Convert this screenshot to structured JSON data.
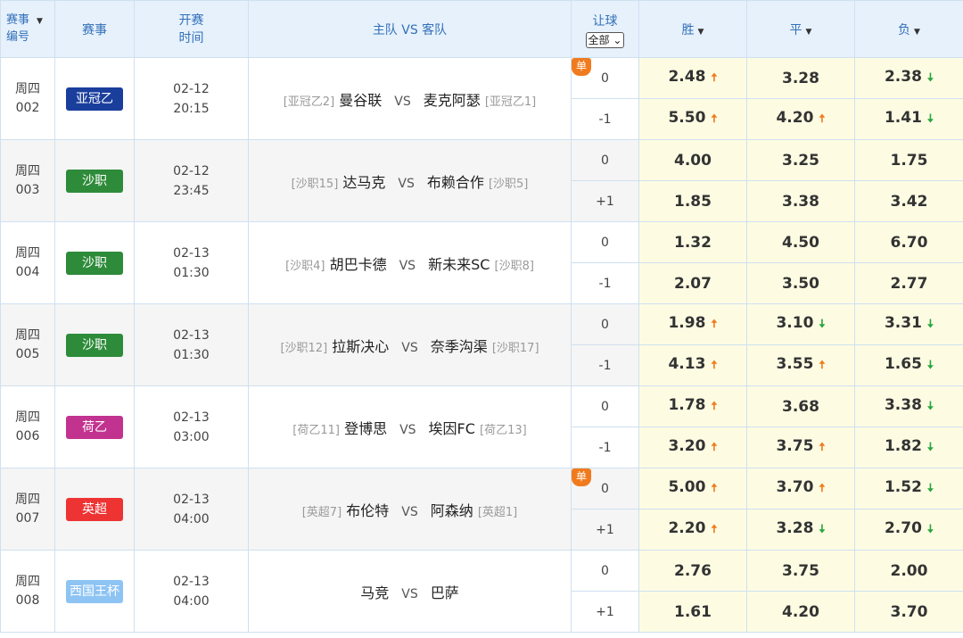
{
  "header": {
    "id_line1": "赛事",
    "id_line2": "编号",
    "league": "赛事",
    "time_line1": "开赛",
    "time_line2": "时间",
    "match": "主队 VS 客队",
    "handicap": "让球",
    "handicap_select": "全部",
    "win": "胜",
    "draw": "平",
    "lose": "负"
  },
  "colors": {
    "亚冠乙": "#1a3e9c",
    "沙职": "#2e8b3a",
    "荷乙": "#c2338f",
    "英超": "#ee3333",
    "西国王杯": "#8ec4f4"
  },
  "matches": [
    {
      "day": "周四",
      "num": "002",
      "league": "亚冠乙",
      "league_color": "#1a3e9c",
      "date": "02-12",
      "time": "20:15",
      "home_tag": "[亚冠乙2]",
      "home": "曼谷联",
      "vs": "VS",
      "away": "麦克阿瑟",
      "away_tag": "[亚冠乙1]",
      "single": "单",
      "rows": [
        {
          "hc": "0",
          "odds": [
            {
              "v": "2.48",
              "t": "up"
            },
            {
              "v": "3.28",
              "t": ""
            },
            {
              "v": "2.38",
              "t": "down"
            }
          ]
        },
        {
          "hc": "-1",
          "odds": [
            {
              "v": "5.50",
              "t": "up"
            },
            {
              "v": "4.20",
              "t": "up"
            },
            {
              "v": "1.41",
              "t": "down"
            }
          ]
        }
      ]
    },
    {
      "day": "周四",
      "num": "003",
      "league": "沙职",
      "league_color": "#2e8b3a",
      "date": "02-12",
      "time": "23:45",
      "home_tag": "[沙职15]",
      "home": "达马克",
      "vs": "VS",
      "away": "布赖合作",
      "away_tag": "[沙职5]",
      "single": "",
      "rows": [
        {
          "hc": "0",
          "odds": [
            {
              "v": "4.00",
              "t": ""
            },
            {
              "v": "3.25",
              "t": ""
            },
            {
              "v": "1.75",
              "t": ""
            }
          ]
        },
        {
          "hc": "+1",
          "odds": [
            {
              "v": "1.85",
              "t": ""
            },
            {
              "v": "3.38",
              "t": ""
            },
            {
              "v": "3.42",
              "t": ""
            }
          ]
        }
      ]
    },
    {
      "day": "周四",
      "num": "004",
      "league": "沙职",
      "league_color": "#2e8b3a",
      "date": "02-13",
      "time": "01:30",
      "home_tag": "[沙职4]",
      "home": "胡巴卡德",
      "vs": "VS",
      "away": "新未来SC",
      "away_tag": "[沙职8]",
      "single": "",
      "rows": [
        {
          "hc": "0",
          "odds": [
            {
              "v": "1.32",
              "t": ""
            },
            {
              "v": "4.50",
              "t": ""
            },
            {
              "v": "6.70",
              "t": ""
            }
          ]
        },
        {
          "hc": "-1",
          "odds": [
            {
              "v": "2.07",
              "t": ""
            },
            {
              "v": "3.50",
              "t": ""
            },
            {
              "v": "2.77",
              "t": ""
            }
          ]
        }
      ]
    },
    {
      "day": "周四",
      "num": "005",
      "league": "沙职",
      "league_color": "#2e8b3a",
      "date": "02-13",
      "time": "01:30",
      "home_tag": "[沙职12]",
      "home": "拉斯决心",
      "vs": "VS",
      "away": "奈季沟渠",
      "away_tag": "[沙职17]",
      "single": "",
      "rows": [
        {
          "hc": "0",
          "odds": [
            {
              "v": "1.98",
              "t": "up"
            },
            {
              "v": "3.10",
              "t": "down"
            },
            {
              "v": "3.31",
              "t": "down"
            }
          ]
        },
        {
          "hc": "-1",
          "odds": [
            {
              "v": "4.13",
              "t": "up"
            },
            {
              "v": "3.55",
              "t": "up"
            },
            {
              "v": "1.65",
              "t": "down"
            }
          ]
        }
      ]
    },
    {
      "day": "周四",
      "num": "006",
      "league": "荷乙",
      "league_color": "#c2338f",
      "date": "02-13",
      "time": "03:00",
      "home_tag": "[荷乙11]",
      "home": "登博思",
      "vs": "VS",
      "away": "埃因FC",
      "away_tag": "[荷乙13]",
      "single": "",
      "rows": [
        {
          "hc": "0",
          "odds": [
            {
              "v": "1.78",
              "t": "up"
            },
            {
              "v": "3.68",
              "t": ""
            },
            {
              "v": "3.38",
              "t": "down"
            }
          ]
        },
        {
          "hc": "-1",
          "odds": [
            {
              "v": "3.20",
              "t": "up"
            },
            {
              "v": "3.75",
              "t": "up"
            },
            {
              "v": "1.82",
              "t": "down"
            }
          ]
        }
      ]
    },
    {
      "day": "周四",
      "num": "007",
      "league": "英超",
      "league_color": "#ee3333",
      "date": "02-13",
      "time": "04:00",
      "home_tag": "[英超7]",
      "home": "布伦特",
      "vs": "VS",
      "away": "阿森纳",
      "away_tag": "[英超1]",
      "single": "单",
      "rows": [
        {
          "hc": "0",
          "odds": [
            {
              "v": "5.00",
              "t": "up"
            },
            {
              "v": "3.70",
              "t": "up"
            },
            {
              "v": "1.52",
              "t": "down"
            }
          ]
        },
        {
          "hc": "+1",
          "odds": [
            {
              "v": "2.20",
              "t": "up"
            },
            {
              "v": "3.28",
              "t": "down"
            },
            {
              "v": "2.70",
              "t": "down"
            }
          ]
        }
      ]
    },
    {
      "day": "周四",
      "num": "008",
      "league": "西国王杯",
      "league_color": "#8ec4f4",
      "date": "02-13",
      "time": "04:00",
      "home_tag": "",
      "home": "马竞",
      "vs": "VS",
      "away": "巴萨",
      "away_tag": "",
      "single": "",
      "rows": [
        {
          "hc": "0",
          "odds": [
            {
              "v": "2.76",
              "t": ""
            },
            {
              "v": "3.75",
              "t": ""
            },
            {
              "v": "2.00",
              "t": ""
            }
          ]
        },
        {
          "hc": "+1",
          "odds": [
            {
              "v": "1.61",
              "t": ""
            },
            {
              "v": "4.20",
              "t": ""
            },
            {
              "v": "3.70",
              "t": ""
            }
          ]
        }
      ]
    }
  ]
}
